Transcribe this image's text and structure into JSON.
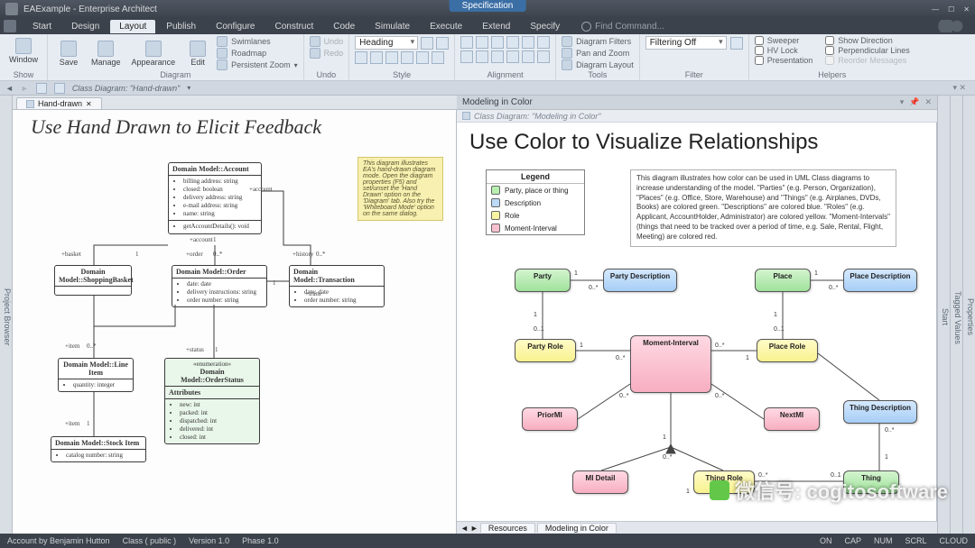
{
  "titlebar": {
    "title": "EAExample - Enterprise Architect",
    "spec_tab": "Specification"
  },
  "menu": {
    "items": [
      "Start",
      "Design",
      "Layout",
      "Publish",
      "Configure",
      "Construct",
      "Code",
      "Simulate",
      "Execute",
      "Extend",
      "Specify"
    ],
    "active_index": 2,
    "find": "Find Command..."
  },
  "ribbon": {
    "groups": {
      "show": {
        "label": "Show",
        "window": "Window",
        "save": "Save"
      },
      "diagram": {
        "label": "Diagram",
        "manage": "Manage",
        "appearance": "Appearance",
        "edit": "Edit",
        "swimlanes": "Swimlanes",
        "roadmap": "Roadmap",
        "pzoom": "Persistent Zoom"
      },
      "undo": {
        "label": "Undo",
        "undo": "Undo",
        "redo": "Redo"
      },
      "style": {
        "label": "Style",
        "heading": "Heading"
      },
      "alignment": {
        "label": "Alignment"
      },
      "tools": {
        "label": "Tools",
        "filters": "Diagram Filters",
        "panzoom": "Pan and Zoom",
        "layout": "Diagram Layout"
      },
      "filter": {
        "label": "Filter",
        "mode": "Filtering Off"
      },
      "helpers": {
        "label": "Helpers",
        "sweeper": "Sweeper",
        "hvlock": "HV Lock",
        "presentation": "Presentation",
        "showdir": "Show Direction",
        "perp": "Perpendicular Lines",
        "reorder": "Reorder Messages"
      }
    }
  },
  "breadcrumb": {
    "label": "Class Diagram: \"Hand-drawn\""
  },
  "left_pane": {
    "tab": "Hand-drawn",
    "title": "Use Hand Drawn to Elicit Feedback",
    "note": "This diagram illustrates EA's hand-drawn diagram mode. Open the diagram properties (F5) and set/unset the 'Hand Drawn' option on the 'Diagram' tab. Also try the 'Whiteboard Mode' option on the same dialog.",
    "boxes": {
      "account": {
        "title": "Domain Model::Account",
        "attrs": [
          "billing address: string",
          "closed: boolean",
          "delivery address: string",
          "e-mail address: string",
          "name: string"
        ],
        "ops": [
          "getAccountDetails(): void"
        ]
      },
      "basket": {
        "title": "Domain Model::ShoppingBasket",
        "attrs": []
      },
      "order": {
        "title": "Domain Model::Order",
        "attrs": [
          "date: date",
          "delivery instructions: string",
          "order number: string"
        ]
      },
      "trans": {
        "title": "Domain Model::Transaction",
        "attrs": [
          "date: date",
          "order number: string"
        ]
      },
      "line": {
        "title": "Domain Model::Line Item",
        "attrs": [
          "quantity: integer"
        ]
      },
      "status": {
        "title": "Domain Model::OrderStatus",
        "stereo": "«enumeration»",
        "section": "Attributes",
        "attrs": [
          "new: int",
          "packed: int",
          "dispatched: int",
          "delivered: int",
          "closed: int"
        ]
      },
      "stock": {
        "title": "Domain Model::Stock Item",
        "attrs": [
          "catalog number: string"
        ]
      }
    },
    "labels": {
      "account": "+account",
      "basket": "+basket",
      "order": "+order",
      "history": "+history",
      "trans": "+trans",
      "item": "+item",
      "status": "+status"
    }
  },
  "right_pane": {
    "header": "Modeling in Color",
    "sub": "Class Diagram: \"Modeling in Color\"",
    "title": "Use Color to Visualize Relationships",
    "legend": {
      "title": "Legend",
      "items": [
        {
          "color": "#b7efb1",
          "label": "Party, place or thing"
        },
        {
          "color": "#bcd9f7",
          "label": "Description"
        },
        {
          "color": "#f9f4a2",
          "label": "Role"
        },
        {
          "color": "#f7c0cf",
          "label": "Moment-Interval"
        }
      ]
    },
    "note": "This diagram illustrates how color can be used in UML Class diagrams to increase understanding of the model. \"Parties\" (e.g. Person, Organization), \"Places\" (e.g. Office, Store, Warehouse) and \"Things\" (e.g. Airplanes, DVDs, Books) are colored green. \"Descriptions\" are colored blue. \"Roles\" (e.g. Applicant, AccountHolder, Administrator) are colored yellow. \"Moment-Intervals\" (things that need to be tracked over a period of time, e.g. Sale, Rental, Flight, Meeting) are colored red.",
    "classes": {
      "party": "Party",
      "party_desc": "Party Description",
      "place": "Place",
      "place_desc": "Place Description",
      "party_role": "Party Role",
      "moment": "Moment-Interval",
      "place_role": "Place Role",
      "prior": "PriorMI",
      "next": "NextMI",
      "thing_desc": "Thing Description",
      "mi_detail": "MI Detail",
      "thing_role": "Thing Role",
      "thing": "Thing"
    },
    "bottom_tabs": [
      "Resources",
      "Modeling in Color"
    ]
  },
  "side_rails": {
    "left": "Project Browser",
    "r1": "Start",
    "r2": "Tagged Values",
    "r3": "Properties"
  },
  "status": {
    "account": "Account by Benjamin Hutton",
    "class": "Class  ( public )",
    "version": "Version 1.0",
    "phase": "Phase 1.0",
    "right": [
      "ON",
      "CAP",
      "NUM",
      "SCRL",
      "CLOUD"
    ]
  },
  "watermark": "微信号: cogitosoftware"
}
